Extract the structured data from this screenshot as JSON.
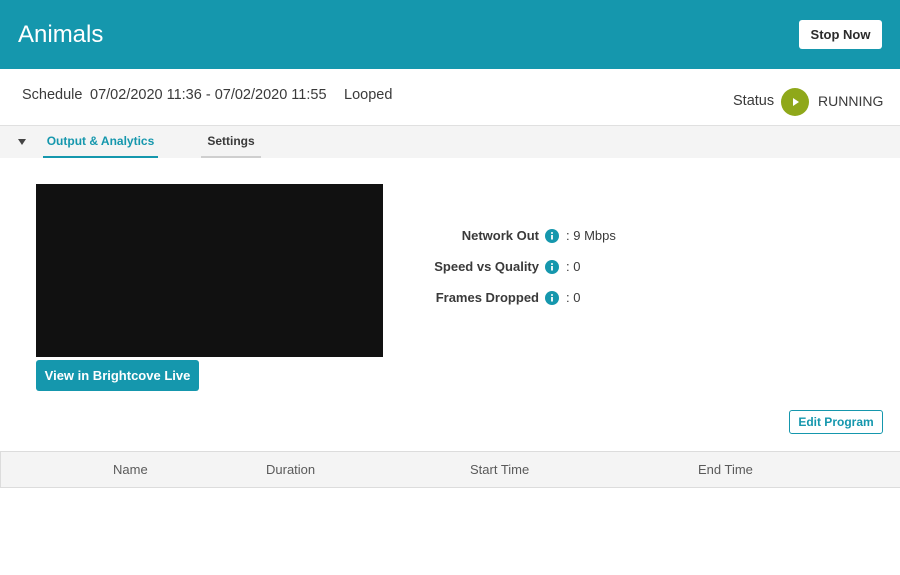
{
  "header": {
    "title": "Animals",
    "stop_button_label": "Stop Now",
    "background_color": "#1597ad"
  },
  "schedule": {
    "label": "Schedule",
    "range": "07/02/2020 11:36 - 07/02/2020 11:55",
    "mode": "Looped"
  },
  "status": {
    "label": "Status",
    "value": "RUNNING",
    "icon": "play-icon",
    "color": "#8fa81a"
  },
  "tabs": {
    "collapse_icon": "triangle-down-icon",
    "items": [
      {
        "label": "Output & Analytics",
        "active": true
      },
      {
        "label": "Settings",
        "active": false
      }
    ]
  },
  "preview": {
    "view_live_label": "View in Brightcove Live"
  },
  "metrics": [
    {
      "label": "Network Out",
      "value": ": 9 Mbps"
    },
    {
      "label": "Speed vs Quality",
      "value": ": 0"
    },
    {
      "label": "Frames Dropped",
      "value": ": 0"
    }
  ],
  "edit_program_label": "Edit Program",
  "table": {
    "columns": [
      "Name",
      "Duration",
      "Start Time",
      "End Time"
    ]
  }
}
